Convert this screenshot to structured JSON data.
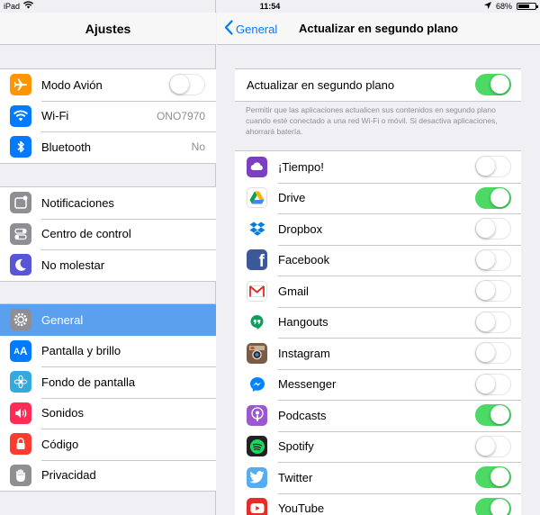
{
  "status": {
    "device": "iPad",
    "time": "11:54",
    "battery": "68%",
    "battery_level": 0.68
  },
  "left": {
    "title": "Ajustes",
    "group1": [
      {
        "label": "Modo Avión",
        "icon": "airplane-icon",
        "color": "#ff9500",
        "toggle": false
      },
      {
        "label": "Wi-Fi",
        "icon": "wifi-icon",
        "color": "#007aff",
        "value": "ONO7970"
      },
      {
        "label": "Bluetooth",
        "icon": "bluetooth-icon",
        "color": "#007aff",
        "value": "No"
      }
    ],
    "group2": [
      {
        "label": "Notificaciones",
        "icon": "notifications-icon",
        "color": "#8e8e93"
      },
      {
        "label": "Centro de control",
        "icon": "control-center-icon",
        "color": "#8e8e93"
      },
      {
        "label": "No molestar",
        "icon": "moon-icon",
        "color": "#5856d6"
      }
    ],
    "group3": [
      {
        "label": "General",
        "icon": "gear-icon",
        "color": "#8e8e93",
        "selected": true
      },
      {
        "label": "Pantalla y brillo",
        "icon": "display-icon",
        "color": "#007aff"
      },
      {
        "label": "Fondo de pantalla",
        "icon": "wallpaper-icon",
        "color": "#34aadc"
      },
      {
        "label": "Sonidos",
        "icon": "sounds-icon",
        "color": "#ff2d55"
      },
      {
        "label": "Código",
        "icon": "lock-icon",
        "color": "#ff3b30"
      },
      {
        "label": "Privacidad",
        "icon": "hand-icon",
        "color": "#8e8e93"
      }
    ]
  },
  "right": {
    "back_label": "General",
    "title": "Actualizar en segundo plano",
    "master": {
      "label": "Actualizar en segundo plano",
      "on": true
    },
    "footnote": "Permitir que las aplicaciones actualicen sus contenidos en segundo plano cuando esté conectado a una red Wi-Fi o móvil. Si desactiva aplicaciones, ahorrará batería.",
    "apps": [
      {
        "label": "¡Tiempo!",
        "icon": "yahoo-weather-icon",
        "color": "#7b3fbf",
        "on": false
      },
      {
        "label": "Drive",
        "icon": "google-drive-icon",
        "color": "#ffffff",
        "on": true
      },
      {
        "label": "Dropbox",
        "icon": "dropbox-icon",
        "color": "#ffffff",
        "on": false
      },
      {
        "label": "Facebook",
        "icon": "facebook-icon",
        "color": "#3b5998",
        "on": false
      },
      {
        "label": "Gmail",
        "icon": "gmail-icon",
        "color": "#ffffff",
        "on": false
      },
      {
        "label": "Hangouts",
        "icon": "hangouts-icon",
        "color": "#ffffff",
        "on": false
      },
      {
        "label": "Instagram",
        "icon": "instagram-icon",
        "color": "#7a5c46",
        "on": false
      },
      {
        "label": "Messenger",
        "icon": "messenger-icon",
        "color": "#ffffff",
        "on": false
      },
      {
        "label": "Podcasts",
        "icon": "podcasts-icon",
        "color": "#9b59d0",
        "on": true
      },
      {
        "label": "Spotify",
        "icon": "spotify-icon",
        "color": "#222222",
        "on": false
      },
      {
        "label": "Twitter",
        "icon": "twitter-icon",
        "color": "#55acee",
        "on": true
      },
      {
        "label": "YouTube",
        "icon": "youtube-icon",
        "color": "#e52d27",
        "on": true
      }
    ]
  }
}
